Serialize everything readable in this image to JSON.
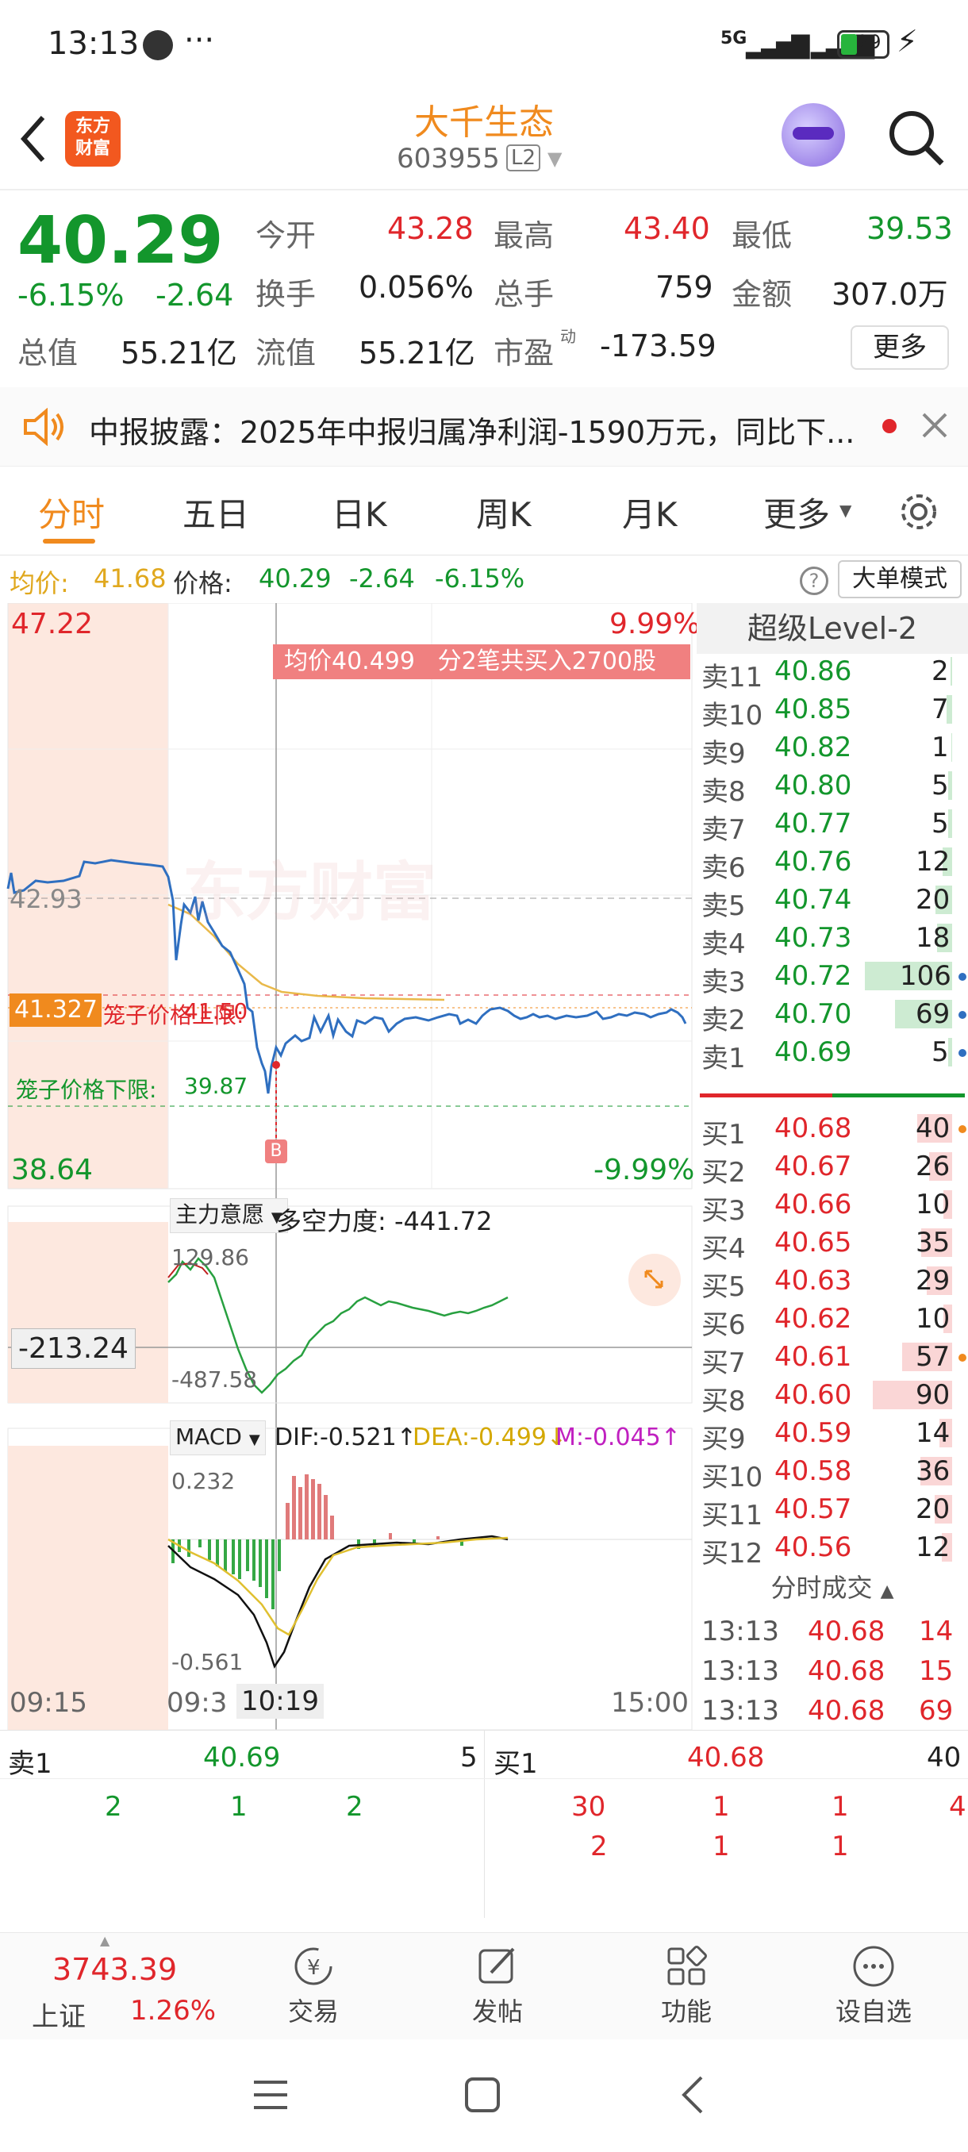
{
  "status": {
    "time": "13:13",
    "signal": "5G",
    "battery": "29"
  },
  "header": {
    "logo_line1": "东方",
    "logo_line2": "财富",
    "name": "大千生态",
    "code": "603955",
    "level_badge": "L2"
  },
  "quote": {
    "price": "40.29",
    "change_pct": "-6.15%",
    "change": "-2.64",
    "open_label": "今开",
    "open": "43.28",
    "high_label": "最高",
    "high": "43.40",
    "low_label": "最低",
    "low": "39.53",
    "turnover_label": "换手",
    "turnover": "0.056%",
    "volume_label": "总手",
    "volume": "759",
    "amount_label": "金额",
    "amount": "307.0万",
    "mktcap_label": "总值",
    "mktcap": "55.21亿",
    "float_label": "流值",
    "float": "55.21亿",
    "pe_label": "市盈",
    "pe_sup": "动",
    "pe": "-173.59",
    "more_button": "更多"
  },
  "notice": {
    "text": "中报披露：2025年中报归属净利润-1590万元，同比下..."
  },
  "tabs": [
    "分时",
    "五日",
    "日K",
    "周K",
    "月K",
    "更多"
  ],
  "avgbar": {
    "avg_label": "均价:",
    "avg": "41.68",
    "price_label": "价格:",
    "price": "40.29",
    "chg": "-2.64",
    "pct": "-6.15%",
    "mode_button": "大单模式"
  },
  "chart": {
    "top_price": "47.22",
    "top_pct": "9.99%",
    "bottom_price": "38.64",
    "bottom_pct": "-9.99%",
    "ref_price": "42.93",
    "cursor_price": "41.327",
    "upper_limit_label": "笼子价格上限:",
    "upper_limit": "41.50",
    "lower_limit_label": "笼子价格下限:",
    "lower_limit": "39.87",
    "tooltip": "均价40.499   分2笔共买入2700股",
    "b_marker": "B",
    "watermark": "东方财富",
    "ind_select": "主力意愿",
    "ind_text": "多空力度: -441.72",
    "ind_top": "129.86",
    "ind_cursor": "-213.24",
    "ind_bottom": "-487.58",
    "macd_select": "MACD",
    "dif": "DIF:-0.521↑",
    "dea": "DEA:-0.499↓",
    "m": "M:-0.045↑",
    "macd_top": "0.232",
    "macd_bottom": "-0.561",
    "time_start": "09:15",
    "time_open": "09:3",
    "time_cursor": "10:19",
    "time_end": "15:00"
  },
  "level2": {
    "title": "超级Level-2",
    "asks": [
      {
        "label": "卖11",
        "price": "40.86",
        "vol": "2"
      },
      {
        "label": "卖10",
        "price": "40.85",
        "vol": "7"
      },
      {
        "label": "卖9",
        "price": "40.82",
        "vol": "1"
      },
      {
        "label": "卖8",
        "price": "40.80",
        "vol": "5"
      },
      {
        "label": "卖7",
        "price": "40.77",
        "vol": "5"
      },
      {
        "label": "卖6",
        "price": "40.76",
        "vol": "12"
      },
      {
        "label": "卖5",
        "price": "40.74",
        "vol": "20"
      },
      {
        "label": "卖4",
        "price": "40.73",
        "vol": "18"
      },
      {
        "label": "卖3",
        "price": "40.72",
        "vol": "106"
      },
      {
        "label": "卖2",
        "price": "40.70",
        "vol": "69"
      },
      {
        "label": "卖1",
        "price": "40.69",
        "vol": "5"
      }
    ],
    "bids": [
      {
        "label": "买1",
        "price": "40.68",
        "vol": "40"
      },
      {
        "label": "买2",
        "price": "40.67",
        "vol": "26"
      },
      {
        "label": "买3",
        "price": "40.66",
        "vol": "10"
      },
      {
        "label": "买4",
        "price": "40.65",
        "vol": "35"
      },
      {
        "label": "买5",
        "price": "40.63",
        "vol": "29"
      },
      {
        "label": "买6",
        "price": "40.62",
        "vol": "10"
      },
      {
        "label": "买7",
        "price": "40.61",
        "vol": "57"
      },
      {
        "label": "买8",
        "price": "40.60",
        "vol": "90"
      },
      {
        "label": "买9",
        "price": "40.59",
        "vol": "14"
      },
      {
        "label": "买10",
        "price": "40.58",
        "vol": "36"
      },
      {
        "label": "买11",
        "price": "40.57",
        "vol": "20"
      },
      {
        "label": "买12",
        "price": "40.56",
        "vol": "12"
      }
    ],
    "trades_title": "分时成交",
    "trades": [
      {
        "time": "13:13",
        "price": "40.68",
        "vol": "14"
      },
      {
        "time": "13:13",
        "price": "40.68",
        "vol": "15"
      },
      {
        "time": "13:13",
        "price": "40.68",
        "vol": "69"
      }
    ]
  },
  "bottom": {
    "sell_label": "卖1",
    "sell_price": "40.69",
    "sell_vol": "5",
    "buy_label": "买1",
    "buy_price": "40.68",
    "buy_vol": "40",
    "sell_queue": [
      "2",
      "1",
      "2"
    ],
    "buy_queue_row1": [
      "30",
      "1",
      "1",
      "4"
    ],
    "buy_queue_row2": [
      "2",
      "1",
      "1"
    ]
  },
  "tabbar": {
    "index_value": "3743.39",
    "index_name": "上证",
    "index_pct": "1.26%",
    "trade": "交易",
    "post": "发帖",
    "function": "功能",
    "watch": "设自选"
  }
}
